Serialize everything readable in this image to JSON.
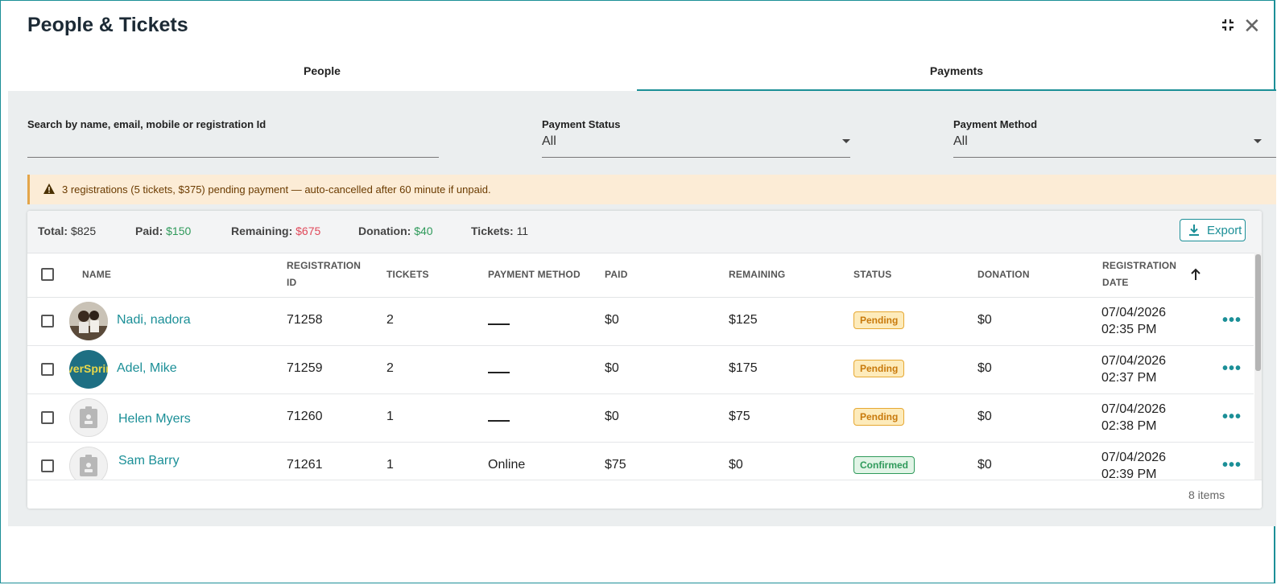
{
  "window": {
    "title": "People & Tickets",
    "collapse_icon": "collapse-icon",
    "close_icon": "close-icon",
    "close_glyph": "✕"
  },
  "tabs": [
    {
      "label": "People",
      "active": false
    },
    {
      "label": "Payments",
      "active": true
    }
  ],
  "filters": {
    "search_label": "Search by name, email, mobile or registration Id",
    "search_value": "",
    "payment_status_label": "Payment Status",
    "payment_status_value": "All",
    "payment_method_label": "Payment Method",
    "payment_method_value": "All"
  },
  "alert": {
    "icon": "warning-icon",
    "text": "3 registrations (5 tickets, $375) pending payment — auto-cancelled after 60 minute if unpaid."
  },
  "summary": {
    "total_label": "Total:",
    "total_value": "$825",
    "paid_label": "Paid:",
    "paid_value": "$150",
    "remaining_label": "Remaining:",
    "remaining_value": "$675",
    "donation_label": "Donation:",
    "donation_value": "$40",
    "tickets_label": "Tickets:",
    "tickets_value": "11",
    "export_label": "Export"
  },
  "table": {
    "headers": {
      "name": "NAME",
      "registration_id_1": "REGISTRATION",
      "registration_id_2": "ID",
      "tickets": "TICKETS",
      "payment_method": "PAYMENT METHOD",
      "paid": "PAID",
      "remaining": "REMAINING",
      "status": "STATUS",
      "donation": "DONATION",
      "registration_date_1": "REGISTRATION",
      "registration_date_2": "DATE"
    },
    "sort_icon": "arrow-up-icon",
    "rows": [
      {
        "name": "Nadi, nadora",
        "avatar": "photo",
        "registration_id": "71258",
        "tickets": "2",
        "payment_method": "",
        "paid": "$0",
        "remaining": "$125",
        "status": "Pending",
        "donation": "$0",
        "date": "07/04/2026",
        "time": "02:35 PM"
      },
      {
        "name": "Adel, Mike",
        "avatar": "logo",
        "avatar_text": "verSprin",
        "registration_id": "71259",
        "tickets": "2",
        "payment_method": "",
        "paid": "$0",
        "remaining": "$175",
        "status": "Pending",
        "donation": "$0",
        "date": "07/04/2026",
        "time": "02:37 PM"
      },
      {
        "name": "Helen Myers",
        "avatar": "placeholder",
        "registration_id": "71260",
        "tickets": "1",
        "payment_method": "",
        "paid": "$0",
        "remaining": "$75",
        "status": "Pending",
        "donation": "$0",
        "date": "07/04/2026",
        "time": "02:38 PM"
      },
      {
        "name": "Sam Barry",
        "avatar": "placeholder",
        "registration_id": "71261",
        "tickets": "1",
        "payment_method": "Online",
        "paid": "$75",
        "remaining": "$0",
        "status": "Confirmed",
        "donation": "$0",
        "date": "07/04/2026",
        "time": "02:39 PM"
      }
    ],
    "footer": "8 items"
  },
  "colors": {
    "accent": "#1b8f97",
    "paid_green": "#2f9a5b",
    "due_red": "#e0495a",
    "pending_bg": "#fdebbb",
    "alert_bg": "#fcecd6"
  }
}
